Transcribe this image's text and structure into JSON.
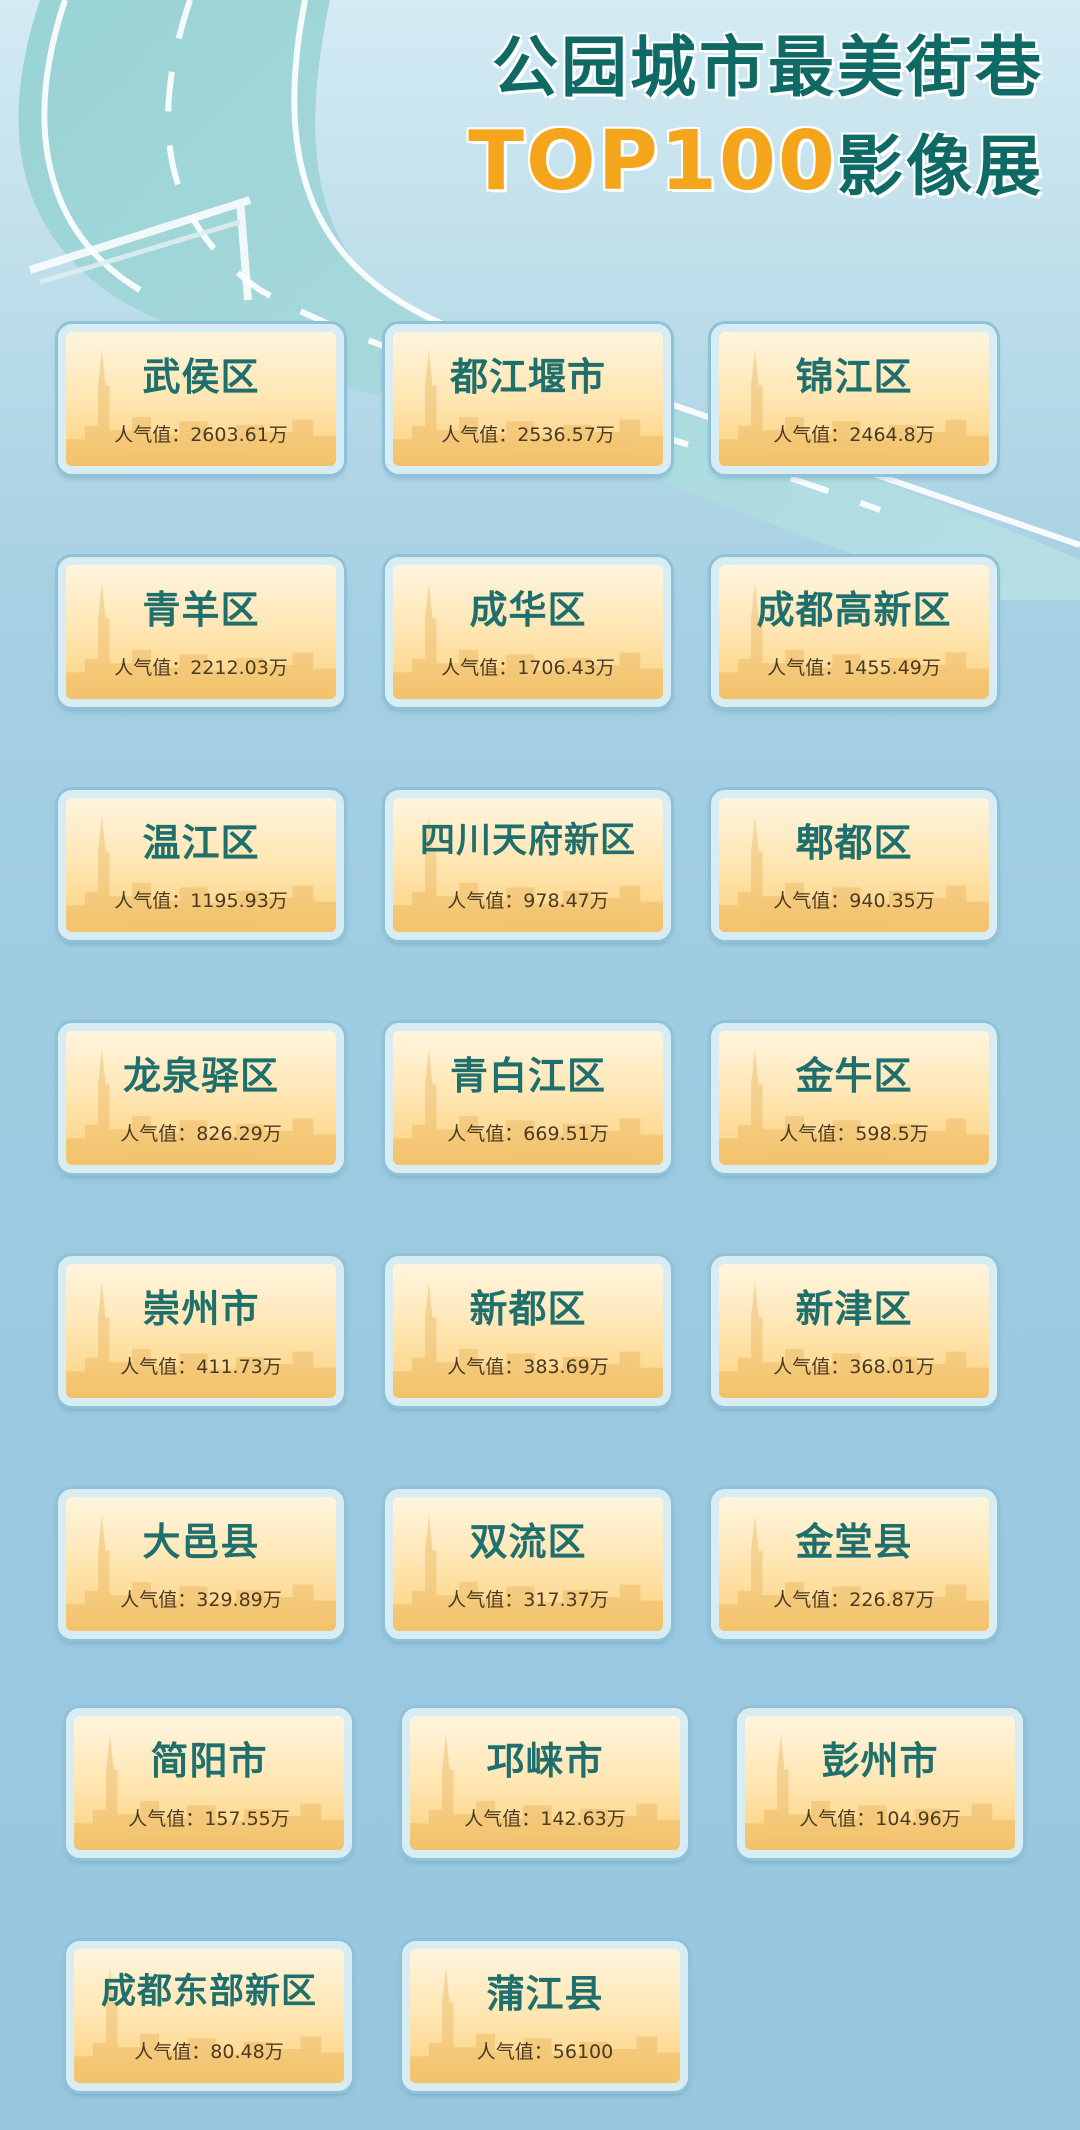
{
  "title": {
    "line1": "公园城市最美街巷",
    "line2_highlight": "TOP100",
    "line2_suffix": "影像展"
  },
  "colors": {
    "title_green": "#0f6a66",
    "title_orange": "#f4a51c",
    "card_gradient_top": "#fff5df",
    "card_gradient_bottom": "#fcd17c",
    "name_text": "#1f6f6c"
  },
  "popularity_label": "人气值：",
  "districts": [
    {
      "name": "武侯区",
      "value": "2603.61万"
    },
    {
      "name": "都江堰市",
      "value": "2536.57万"
    },
    {
      "name": "锦江区",
      "value": "2464.8万"
    },
    {
      "name": "青羊区",
      "value": "2212.03万"
    },
    {
      "name": "成华区",
      "value": "1706.43万"
    },
    {
      "name": "成都高新区",
      "value": "1455.49万"
    },
    {
      "name": "温江区",
      "value": "1195.93万"
    },
    {
      "name": "四川天府新区",
      "value": "978.47万"
    },
    {
      "name": "郫都区",
      "value": "940.35万"
    },
    {
      "name": "龙泉驿区",
      "value": "826.29万"
    },
    {
      "name": "青白江区",
      "value": "669.51万"
    },
    {
      "name": "金牛区",
      "value": "598.5万"
    },
    {
      "name": "崇州市",
      "value": "411.73万"
    },
    {
      "name": "新都区",
      "value": "383.69万"
    },
    {
      "name": "新津区",
      "value": "368.01万"
    },
    {
      "name": "大邑县",
      "value": "329.89万"
    },
    {
      "name": "双流区",
      "value": "317.37万"
    },
    {
      "name": "金堂县",
      "value": "226.87万"
    },
    {
      "name": "简阳市",
      "value": "157.55万"
    },
    {
      "name": "邛崃市",
      "value": "142.63万"
    },
    {
      "name": "彭州市",
      "value": "104.96万"
    },
    {
      "name": "成都东部新区",
      "value": "80.48万"
    },
    {
      "name": "蒲江县",
      "value": "56100"
    }
  ]
}
